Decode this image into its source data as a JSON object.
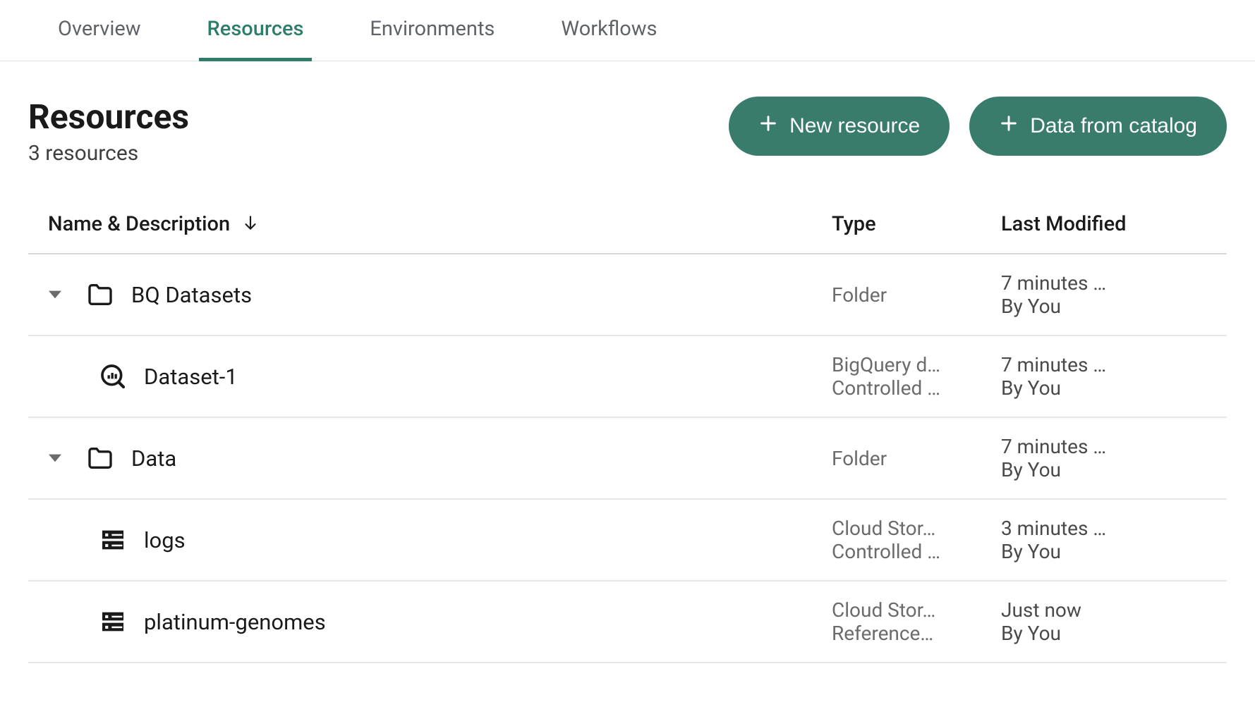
{
  "tabs": {
    "overview": "Overview",
    "resources": "Resources",
    "environments": "Environments",
    "workflows": "Workflows"
  },
  "header": {
    "title": "Resources",
    "subtitle": "3 resources",
    "new_resource": "New resource",
    "data_from_catalog": "Data from catalog"
  },
  "columns": {
    "name": "Name & Description",
    "type": "Type",
    "modified": "Last Modified"
  },
  "rows": [
    {
      "name": "BQ Datasets",
      "type1": "Folder",
      "type2": "",
      "mod1": "7 minutes …",
      "mod2": "By You",
      "icon": "folder",
      "indent": 0,
      "expandable": true
    },
    {
      "name": "Dataset-1",
      "type1": "BigQuery d…",
      "type2": "Controlled …",
      "mod1": "7 minutes …",
      "mod2": "By You",
      "icon": "bq",
      "indent": 1,
      "expandable": false
    },
    {
      "name": "Data",
      "type1": "Folder",
      "type2": "",
      "mod1": "7 minutes …",
      "mod2": "By You",
      "icon": "folder",
      "indent": 0,
      "expandable": true
    },
    {
      "name": "logs",
      "type1": "Cloud Stor…",
      "type2": "Controlled …",
      "mod1": "3 minutes …",
      "mod2": "By You",
      "icon": "storage",
      "indent": 1,
      "expandable": false
    },
    {
      "name": "platinum-genomes",
      "type1": "Cloud Stor…",
      "type2": "Reference…",
      "mod1": "Just now",
      "mod2": "By You",
      "icon": "storage",
      "indent": 1,
      "expandable": false
    }
  ]
}
